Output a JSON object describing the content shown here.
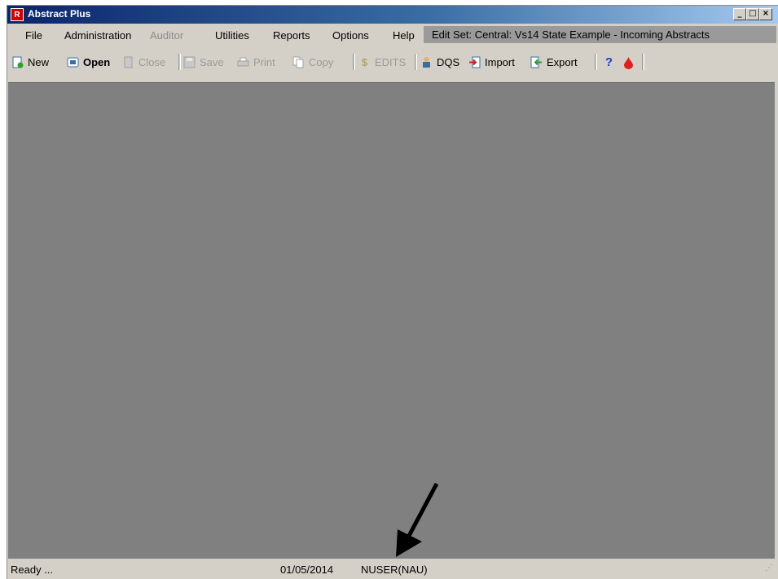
{
  "window": {
    "title": "Abstract Plus",
    "icon": "app-logo-icon",
    "controls": [
      "minimize",
      "maximize",
      "close"
    ]
  },
  "menubar": {
    "items": [
      {
        "label": "File",
        "enabled": true
      },
      {
        "label": "Administration",
        "enabled": true
      },
      {
        "label": "Auditor",
        "enabled": false
      },
      {
        "label": "Utilities",
        "enabled": true
      },
      {
        "label": "Reports",
        "enabled": true
      },
      {
        "label": "Options",
        "enabled": true
      },
      {
        "label": "Help",
        "enabled": true
      }
    ],
    "edit_set": "Edit Set: Central: Vs14 State Example - Incoming Abstracts"
  },
  "toolbar": {
    "items": [
      {
        "label": "New",
        "icon": "new-document-icon",
        "enabled": true
      },
      {
        "label": "Open",
        "icon": "open-icon",
        "enabled": true
      },
      {
        "label": "Close",
        "icon": "close-document-icon",
        "enabled": false
      },
      {
        "label": "Save",
        "icon": "save-icon",
        "enabled": false
      },
      {
        "label": "Print",
        "icon": "print-icon",
        "enabled": false
      },
      {
        "label": "Copy",
        "icon": "copy-icon",
        "enabled": false
      },
      {
        "label": "EDITS",
        "icon": "edits-icon",
        "enabled": false
      },
      {
        "label": "DQS",
        "icon": "dqs-icon",
        "enabled": true
      },
      {
        "label": "Import",
        "icon": "import-icon",
        "enabled": true
      },
      {
        "label": "Export",
        "icon": "export-icon",
        "enabled": true
      },
      {
        "label": "",
        "icon": "help-icon",
        "enabled": true
      },
      {
        "label": "",
        "icon": "drop-icon",
        "enabled": true
      }
    ]
  },
  "statusbar": {
    "status": "Ready ...",
    "date": "01/05/2014",
    "user": "NUSER(NAU)"
  },
  "colors": {
    "chrome": "#d4d0c8",
    "workspace": "#808080",
    "edit_set_bg": "#9a9a9a",
    "disabled_text": "#8a8a8a"
  }
}
